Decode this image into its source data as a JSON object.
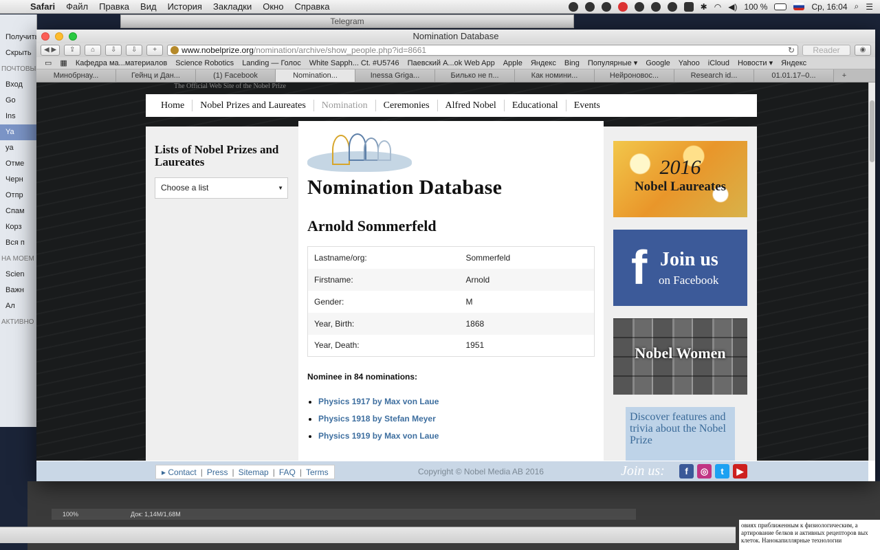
{
  "menubar": {
    "app": "Safari",
    "items": [
      "Файл",
      "Правка",
      "Вид",
      "История",
      "Закладки",
      "Окно",
      "Справка"
    ],
    "battery": "100 %",
    "clock": "Ср, 16:04"
  },
  "telegram": {
    "title": "Telegram"
  },
  "mail_sidebar": {
    "items": [
      "Получить п",
      "Скрыть",
      "ПОЧТОВЫ",
      "Вход",
      "Go",
      "Ins",
      "Ya",
      "ya",
      "Отме",
      "Черн",
      "Отпр",
      "Спам",
      "Корз",
      "Вся п",
      "НА МОЕМ",
      "Scien",
      "Важн",
      "Ал",
      "АКТИВНО"
    ]
  },
  "window": {
    "title": "Nomination Database",
    "url_domain": "www.nobelprize.org",
    "url_path": "/nomination/archive/show_people.php?id=8661",
    "reader": "Reader"
  },
  "bookmarks": [
    "Кафедра ма...материалов",
    "Science Robotics",
    "Landing — Голос",
    "White Sapph... Ct. #U5746",
    "Паевский А...ok Web App",
    "Apple",
    "Яндекс",
    "Bing",
    "Популярные ▾",
    "Google",
    "Yahoo",
    "iCloud",
    "Новости ▾",
    "Яндекс"
  ],
  "tabs": [
    "Минобрнау...",
    "Гейнц и Дан...",
    "(1) Facebook",
    "Nomination...",
    "Inessa Griga...",
    "Билько не п...",
    "Как номини...",
    "Нейроновос...",
    "Research id...",
    "01.01.17–0..."
  ],
  "site": {
    "tagline": "The Official Web Site of the Nobel Prize",
    "nav": [
      "Home",
      "Nobel Prizes and Laureates",
      "Nomination",
      "Ceremonies",
      "Alfred Nobel",
      "Educational",
      "Events"
    ],
    "left_title": "Lists of Nobel Prizes and Laureates",
    "select_value": "Choose a list",
    "page_title": "Nomination Database",
    "person": "Arnold Sommerfeld",
    "fields": [
      {
        "label": "Lastname/org:",
        "value": "Sommerfeld"
      },
      {
        "label": "Firstname:",
        "value": "Arnold"
      },
      {
        "label": "Gender:",
        "value": "M"
      },
      {
        "label": "Year, Birth:",
        "value": "1868"
      },
      {
        "label": "Year, Death:",
        "value": "1951"
      }
    ],
    "nominee_text": "Nominee in 84 nominations:",
    "nominations": [
      "Physics 1917 by Max von Laue",
      "Physics 1918 by Stefan Meyer",
      "Physics 1919 by Max von Laue"
    ],
    "banners": {
      "laureates_year": "2016",
      "laureates_label": "Nobel Laureates",
      "fb_join": "Join us",
      "fb_on": "on Facebook",
      "women": "Nobel Women",
      "discover": "Discover features and trivia about the Nobel Prize"
    },
    "footer": {
      "links": [
        "▸ Contact",
        "Press",
        "Sitemap",
        "FAQ",
        "Terms"
      ],
      "copyright": "Copyright © Nobel Media AB 2016",
      "join": "Join us:"
    }
  },
  "bottom": {
    "zoom": "100%",
    "doc": "Док: 1,14M/1,68M"
  },
  "doc_text": "овиях приближенным к физиологическим, а артирование белков и активных рецепторов вых клеток. Нанокапиллярные технологии"
}
